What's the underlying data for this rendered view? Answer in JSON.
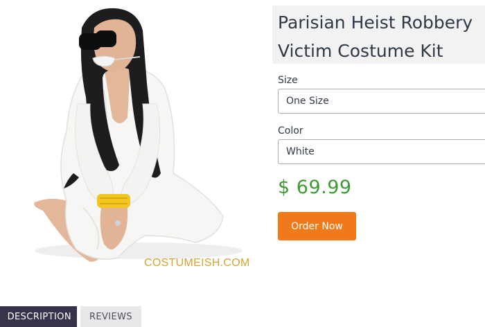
{
  "product": {
    "title_line1": "Parisian Heist Robbery",
    "title_line2": "Victim Costume Kit",
    "image_watermark": "COSTUMEISH.COM",
    "price": "$ 69.99",
    "order_button_label": "Order Now"
  },
  "options": {
    "size": {
      "label": "Size",
      "value": "One Size"
    },
    "color": {
      "label": "Color",
      "value": "White"
    }
  },
  "tabs": [
    {
      "label": "DESCRIPTION",
      "active": true
    },
    {
      "label": "REVIEWS",
      "active": false
    }
  ],
  "colors": {
    "accent_orange": "#f07a1a",
    "price_green": "#3f9a35",
    "active_tab": "#37334c",
    "inactive_tab": "#e8e8ea",
    "watermark_gold": "#d4a52c"
  },
  "icons": [
    "product-photo"
  ]
}
